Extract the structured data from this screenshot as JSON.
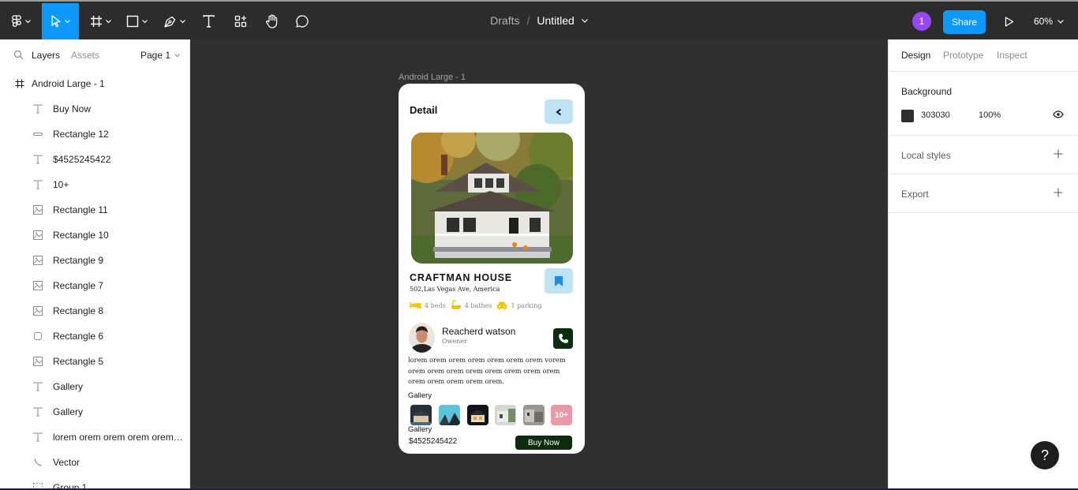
{
  "toolbar": {
    "icons": [
      "figma-menu-icon",
      "move-tool-icon",
      "frame-tool-icon",
      "shape-tool-icon",
      "pen-tool-icon",
      "text-tool-icon",
      "resources-icon",
      "hand-tool-icon",
      "comment-icon"
    ],
    "breadcrumb_drafts": "Drafts",
    "breadcrumb_sep": "/",
    "file_title": "Untitled",
    "user_badge": "1",
    "share_label": "Share",
    "zoom_label": "60%",
    "colors": {
      "accent": "#0d99ff",
      "user": "#9747ff",
      "bar_bg": "#2c2c2c"
    }
  },
  "left_panel": {
    "tab_layers": "Layers",
    "tab_assets": "Assets",
    "page_select": "Page 1",
    "frame_layer": "Android Large - 1",
    "layers": [
      {
        "label": "Buy Now",
        "icon": "text-layer-icon"
      },
      {
        "label": "Rectangle 12",
        "icon": "rectangle-layer-icon"
      },
      {
        "label": "$4525245422",
        "icon": "text-layer-icon"
      },
      {
        "label": "10+",
        "icon": "text-layer-icon"
      },
      {
        "label": "Rectangle 11",
        "icon": "image-layer-icon"
      },
      {
        "label": "Rectangle 10",
        "icon": "image-layer-icon"
      },
      {
        "label": "Rectangle 9",
        "icon": "image-layer-icon"
      },
      {
        "label": "Rectangle 7",
        "icon": "image-layer-icon"
      },
      {
        "label": "Rectangle 8",
        "icon": "image-layer-icon"
      },
      {
        "label": "Rectangle 6",
        "icon": "rounded-rect-layer-icon"
      },
      {
        "label": "Rectangle 5",
        "icon": "image-layer-icon"
      },
      {
        "label": "Gallery",
        "icon": "text-layer-icon"
      },
      {
        "label": "Gallery",
        "icon": "text-layer-icon"
      },
      {
        "label": "lorem orem orem orem orem ...",
        "icon": "text-layer-icon"
      },
      {
        "label": "Vector",
        "icon": "vector-layer-icon"
      },
      {
        "label": "Group 1",
        "icon": "group-layer-icon"
      }
    ]
  },
  "canvas": {
    "background": "#303030",
    "frame_label": "Android Large - 1",
    "screen": {
      "title": "Detail",
      "house_name": "CRAFTMAN HOUSE",
      "address": "502,Las Vegas Ave, America",
      "amenities": [
        {
          "icon": "bed-icon",
          "label": "4 beds"
        },
        {
          "icon": "bath-icon",
          "label": "4 bathes"
        },
        {
          "icon": "car-icon",
          "label": "1 parking"
        }
      ],
      "owner_name": "Reacherd watson",
      "owner_role": "Owener",
      "description": "lorem orem orem orem orem orem orem vorem orem orem orem orem orem orem orem orem orem orem orem orem orem.",
      "gallery_title": "Gallery",
      "gallery_more": "10+",
      "gallery_title_2": "Gallery",
      "price": "$4525245422",
      "buy_label": "Buy Now",
      "colors": {
        "accent_light": "#bfe3f3",
        "dark_green": "#0d2b0d",
        "amenity_yellow": "#f5c400"
      }
    }
  },
  "right_panel": {
    "tab_design": "Design",
    "tab_prototype": "Prototype",
    "tab_inspect": "Inspect",
    "background_heading": "Background",
    "bg_hex": "303030",
    "bg_opacity": "100%",
    "local_styles": "Local styles",
    "export": "Export"
  },
  "help_label": "?"
}
